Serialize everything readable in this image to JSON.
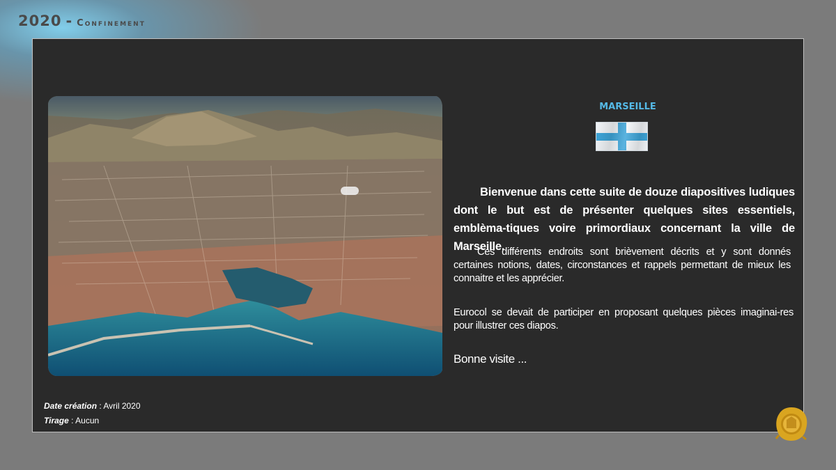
{
  "header": {
    "year": "2020",
    "separator": "-",
    "label": "Confinement"
  },
  "slide": {
    "city": "MARSEILLE",
    "photo_icon": "aerial-city-photo",
    "flag_icon": "marseille-flag-icon",
    "paragraph1": "Bienvenue dans  cette suite de douze diapositives ludiques dont le but est de présenter quelques sites essentiels, emblèma-tiques  voire primordiaux concernant la ville de Marseille.",
    "paragraph2": "Ces différents endroits sont brièvement décrits et y sont donnés certaines notions, dates, circonstances et rappels permettant de mieux les connaitre  et les apprécier.",
    "paragraph3": "Eurocol se devait de participer en proposant quelques pièces imaginai-res pour illustrer ces diapos.",
    "closing": "Bonne visite ..."
  },
  "meta": {
    "creation_label": "Date création",
    "creation_value": "Avril 2020",
    "tirage_label": "Tirage",
    "tirage_value": "Aucun",
    "separator": " : "
  },
  "seal": {
    "icon": "eurocol-wax-seal-icon"
  },
  "colors": {
    "background": "#7b7b7b",
    "panel": "#2a2a2a",
    "accent_blue": "#55b9e6",
    "seal_gold": "#d9a520"
  }
}
